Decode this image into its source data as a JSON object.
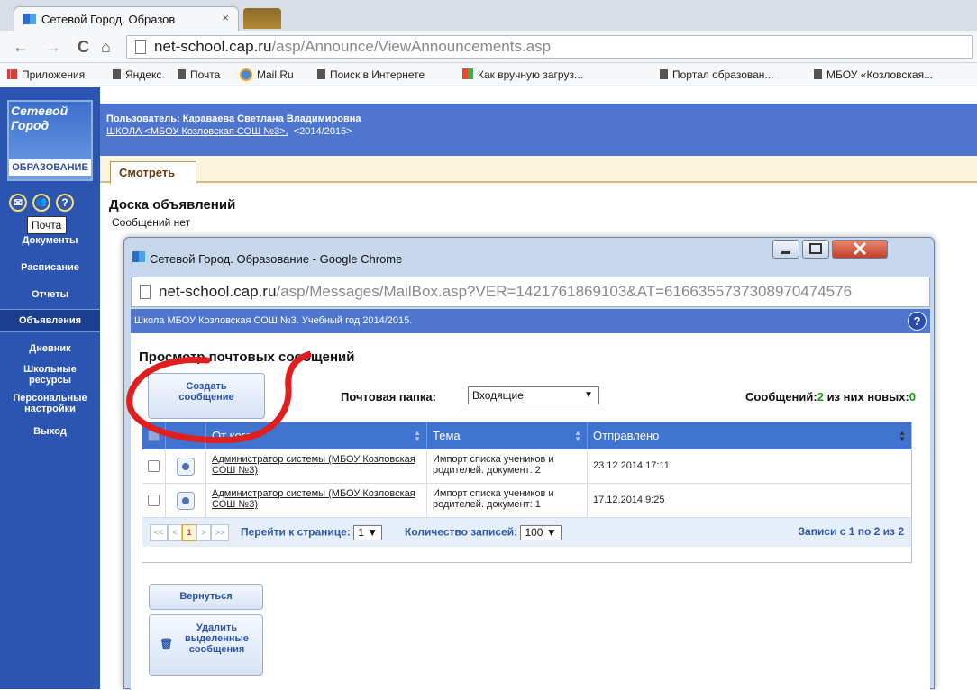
{
  "browser": {
    "tab_title": "Сетевой Город. Образов",
    "tab_close": "×",
    "url_host": "net-school.cap.ru",
    "url_path": "/asp/Announce/ViewAnnouncements.asp",
    "back": "←",
    "forward": "→",
    "reload": "C",
    "home": "⌂",
    "bookmarks": [
      "Приложения",
      "Яндекс",
      "Почта",
      "Mail.Ru",
      "Поиск в Интернете",
      "Как вручную загруз...",
      "Портал образован...",
      "МБОУ «Козловская..."
    ]
  },
  "logo": {
    "line1": "Сетевой",
    "line2": "Город",
    "line3": "ОБРАЗОВАНИЕ"
  },
  "left_nav": {
    "icons": {
      "mail": "✉",
      "people": "👥",
      "help": "?"
    },
    "tooltip": "Почта",
    "items": [
      "Документы",
      "Расписание",
      "Отчеты",
      "Объявления",
      "Дневник",
      "Школьные ресурсы",
      "Персональные настройки",
      "Выход"
    ]
  },
  "user_bar": {
    "user": "Пользователь: Караваева Светлана Владимировна",
    "school_link": "ШКОЛА <МБОУ Козловская СОШ №3>,",
    "year": "<2014/2015>"
  },
  "subtab": "Смотреть",
  "board": {
    "title": "Доска объявлений",
    "empty": "Сообщений нет"
  },
  "popup": {
    "window_title": "Сетевой Город. Образование - Google Chrome",
    "url_host": "net-school.cap.ru",
    "url_path": "/asp/Messages/MailBox.asp?VER=1421761869103&AT=6166355737308970474576",
    "header": "Школа МБОУ Козловская СОШ №3. Учебный год 2014/2015.",
    "help": "?",
    "title": "Просмотр почтовых сообщений",
    "create_button": "Создать сообщение",
    "folder_label": "Почтовая папка:",
    "folder_value": "Входящие",
    "count_label": "Сообщений:",
    "count_total": "2",
    "count_mid": " из них новых:",
    "count_new": "0",
    "columns": [
      "От кого",
      "Тема",
      "Отправлено"
    ],
    "rows": [
      {
        "from": "Администратор системы (МБОУ Козловская СОШ №3)",
        "subject": "Импорт списка учеников и родителей. документ: 2",
        "sent": "23.12.2014 17:11"
      },
      {
        "from": "Администратор системы (МБОУ Козловская СОШ №3)",
        "subject": "Импорт списка учеников и родителей. документ: 1",
        "sent": "17.12.2014 9:25"
      }
    ],
    "pager": {
      "first": "<<",
      "prev": "<",
      "page": "1",
      "next": ">",
      "last": ">>",
      "goto_label": "Перейти к странице:",
      "goto_value": "1",
      "per_page_label": "Количество записей:",
      "per_page_value": "100",
      "records": "Записи с 1 по 2 из 2"
    },
    "back_button": "Вернуться",
    "delete_button": "Удалить выделенные сообщения"
  },
  "annotation_color": "#e02020"
}
